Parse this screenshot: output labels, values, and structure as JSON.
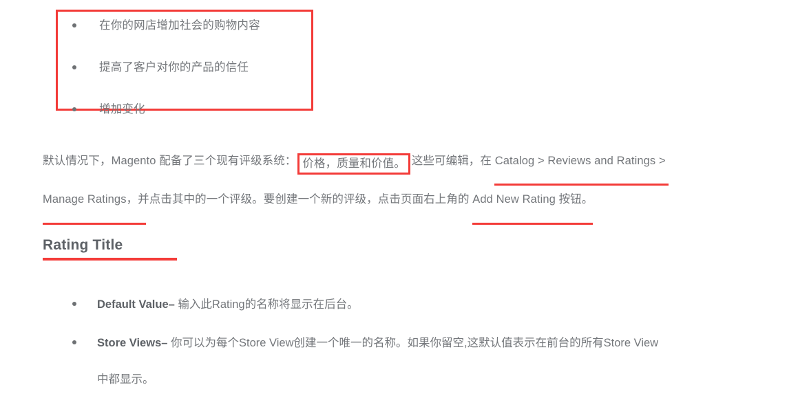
{
  "colors": {
    "accent_red": "#f33b38",
    "body_text": "#74777b",
    "heading_text": "#5d6166",
    "background": "#ffffff"
  },
  "boxed_list": {
    "items": [
      "在你的网店增加社会的购物内容",
      "提高了客户对你的产品的信任",
      "增加变化"
    ]
  },
  "paragraph": {
    "line1_before_box": "默认情况下，Magento 配备了三个现有评级系统：",
    "line1_boxed": "价格，质量和价值。",
    "line1_after_box": "这些可编辑，在 ",
    "line1_underlined": "Catalog > Reviews and Ratings >",
    "line2_underlined": "Manage Ratings，",
    "line2_middle": "并点击其中的一个评级。要创建一个新的评级，点击页面右上角的 ",
    "line2_underlined_2": "Add New Rating 按钮。"
  },
  "heading": {
    "text": "Rating Title"
  },
  "bottom_list": {
    "items": [
      {
        "term": "Default Value",
        "dash": "–",
        "description": "输入此Rating的名称将显示在后台。",
        "continuation": ""
      },
      {
        "term": "Store Views",
        "dash": "–",
        "description": "你可以为每个Store View创建一个唯一的名称。如果你留空,这默认值表示在前台的所有Store View",
        "continuation": "中都显示。"
      }
    ]
  }
}
